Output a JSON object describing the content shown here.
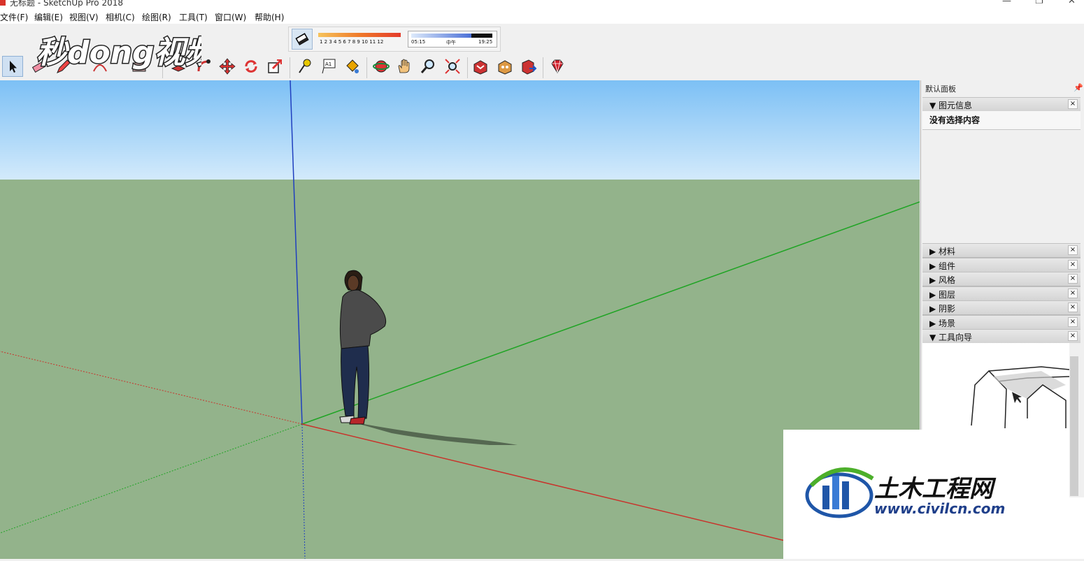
{
  "window": {
    "title": "无标题 - SketchUp Pro 2018",
    "minimize": "—",
    "maximize": "❐",
    "close": "✕"
  },
  "menu": [
    "文件(F)",
    "编辑(E)",
    "视图(V)",
    "相机(C)",
    "绘图(R)",
    "工具(T)",
    "窗口(W)",
    "帮助(H)"
  ],
  "shadow_toolbar": {
    "months": "1 2 3 4 5 6 7 8 9 10 11 12",
    "time_start": "05:15",
    "time_mid": "中午",
    "time_end": "19:25"
  },
  "watermark_top": "秒dong视频",
  "watermark_bottom": {
    "name": "土木工程网",
    "url": "www.civilcn.com"
  },
  "tray": {
    "title": "默认面板",
    "pin": "📌",
    "entity_info": {
      "label": "▼ 图元信息",
      "body": "没有选择内容"
    },
    "collapsed": [
      {
        "label": "▶ 材料"
      },
      {
        "label": "▶ 组件"
      },
      {
        "label": "▶ 风格"
      },
      {
        "label": "▶ 图层"
      },
      {
        "label": "▶ 阴影"
      },
      {
        "label": "▶ 场景"
      }
    ],
    "instructor": {
      "label": "▼ 工具向导"
    },
    "close_glyph": "×"
  },
  "colors": {
    "sky_top": "#7dbff5",
    "sky_bottom": "#d7ecfb",
    "ground": "#93b38b",
    "axis_red": "#c8332b",
    "axis_green": "#1fa424",
    "axis_blue": "#1f3fbf"
  }
}
